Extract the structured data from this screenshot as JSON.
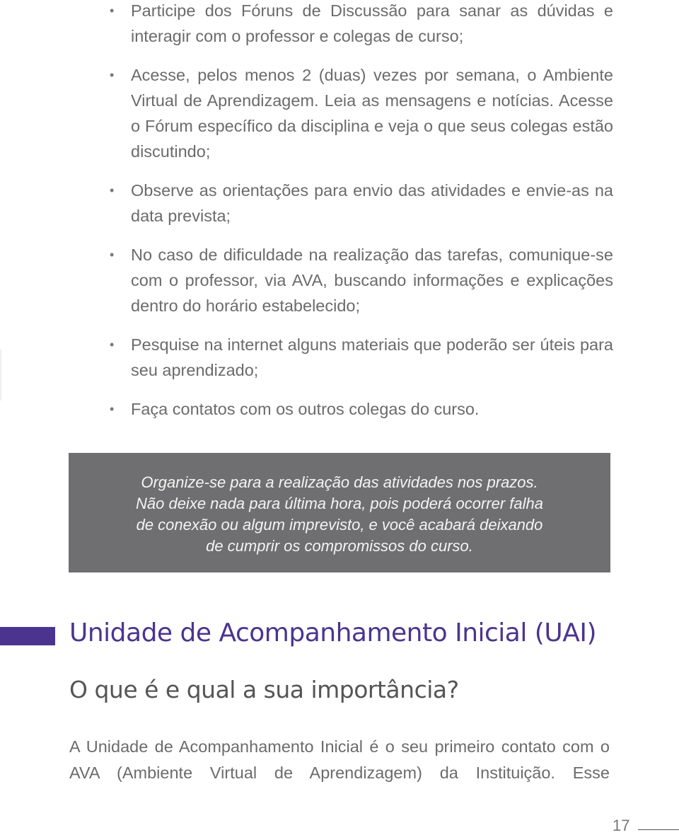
{
  "bullets": [
    {
      "text": "Participe dos Fóruns de Discussão para sanar as dúvidas e interagir com o professor e colegas de curso;"
    },
    {
      "text": "Acesse, pelos menos  2 (duas) vezes por semana, o Ambiente Virtual de Aprendizagem. Leia as mensagens e notícias. Acesse o Fórum específico da disciplina e veja o que seus colegas estão discutindo;"
    },
    {
      "text": "Observe as orientações para envio das atividades e envie-as na data prevista;"
    },
    {
      "text": "No caso de dificuldade na realização das tarefas, comunique-se com o professor, via AVA, buscando informações e explicações dentro do horário estabelecido;"
    },
    {
      "text": "Pesquise na internet alguns materiais que poderão ser úteis para seu aprendizado;"
    },
    {
      "text": "Faça contatos com os outros colegas do curso."
    }
  ],
  "bullet_glyph": "•",
  "callout": {
    "lines": [
      "Organize-se para a realização das atividades nos prazos.",
      "Não deixe nada para última hora, pois poderá ocorrer falha",
      "de conexão ou algum imprevisto, e você acabará deixando",
      "de cumprir os compromissos do curso."
    ]
  },
  "section": {
    "title": "Unidade de Acompanhamento Inicial (UAI)",
    "subtitle": "O que é e qual a sua importância?",
    "body": "A Unidade de Acompanhamento Inicial é o seu primeiro contato com o AVA (Ambiente Virtual de Aprendizagem) da Instituição. Esse",
    "accent_color": "#4b3490"
  },
  "page_number": "17"
}
